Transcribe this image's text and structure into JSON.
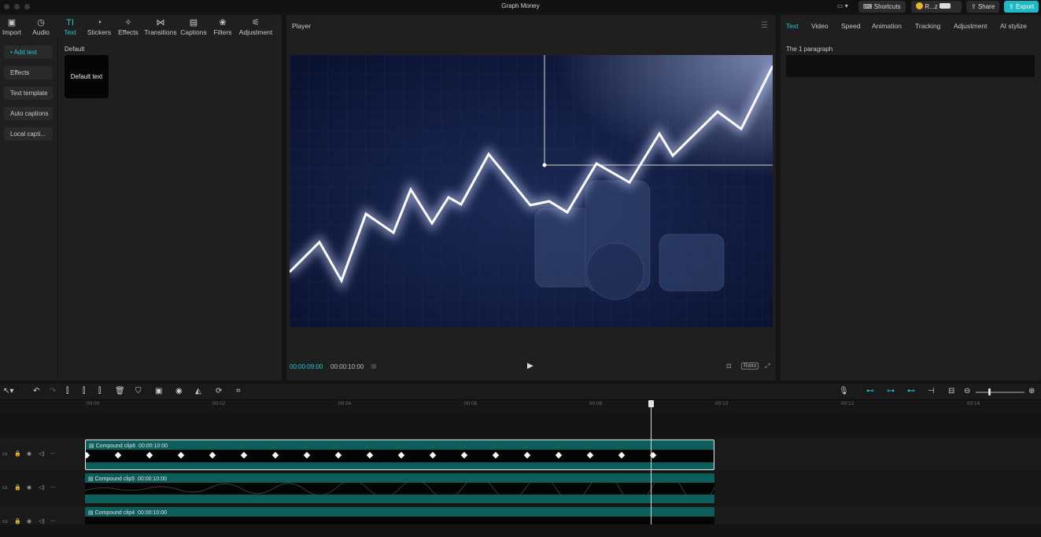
{
  "app": {
    "title": "Graph Money"
  },
  "topbar": {
    "shortcuts_label": "Shortcuts",
    "user_label": "R...z",
    "share_label": "Share",
    "export_label": "Export",
    "accent_color": "#1fb9c5"
  },
  "toolbar": {
    "tabs": [
      {
        "label": "Import",
        "icon": "import-icon"
      },
      {
        "label": "Audio",
        "icon": "audio-icon"
      },
      {
        "label": "Text",
        "icon": "text-icon",
        "active": true
      },
      {
        "label": "Stickers",
        "icon": "stickers-icon"
      },
      {
        "label": "Effects",
        "icon": "effects-icon"
      },
      {
        "label": "Transitions",
        "icon": "transitions-icon"
      },
      {
        "label": "Captions",
        "icon": "captions-icon"
      },
      {
        "label": "Filters",
        "icon": "filters-icon"
      },
      {
        "label": "Adjustment",
        "icon": "adjustment-icon"
      }
    ]
  },
  "sidebar": {
    "items": [
      {
        "label": "• Add text",
        "active": true
      },
      {
        "label": "Effects"
      },
      {
        "label": "Text template"
      },
      {
        "label": "Auto captions"
      },
      {
        "label": "Local capti..."
      }
    ]
  },
  "library": {
    "section_label": "Default",
    "tile_label": "Default text"
  },
  "player": {
    "title": "Player",
    "current_time": "00:00:09:00",
    "total_time": "00:00:10:00",
    "ratio_label": "Ratio"
  },
  "inspector": {
    "tabs": [
      "Text",
      "Video",
      "Speed",
      "Animation",
      "Tracking",
      "Adjustment",
      "AI stylize"
    ],
    "active_tab": "Text",
    "paragraph_label": "The 1 paragraph"
  },
  "timeline": {
    "ruler_ticks": [
      "00:00",
      "00:02",
      "00:04",
      "00:06",
      "00:08",
      "00:10",
      "00:12",
      "00:14"
    ],
    "tracks": [
      {
        "clip_name": "Compound clip6",
        "duration": "00:00:10:00",
        "selected": true,
        "keyframe_count": 19
      },
      {
        "clip_name": "Compound clip5",
        "duration": "00:00:10:00"
      },
      {
        "clip_name": "Compound clip4",
        "duration": "00:00:10:00"
      }
    ],
    "playhead_time": "00:00:09:00",
    "clip_color": "#0d5d5a"
  }
}
